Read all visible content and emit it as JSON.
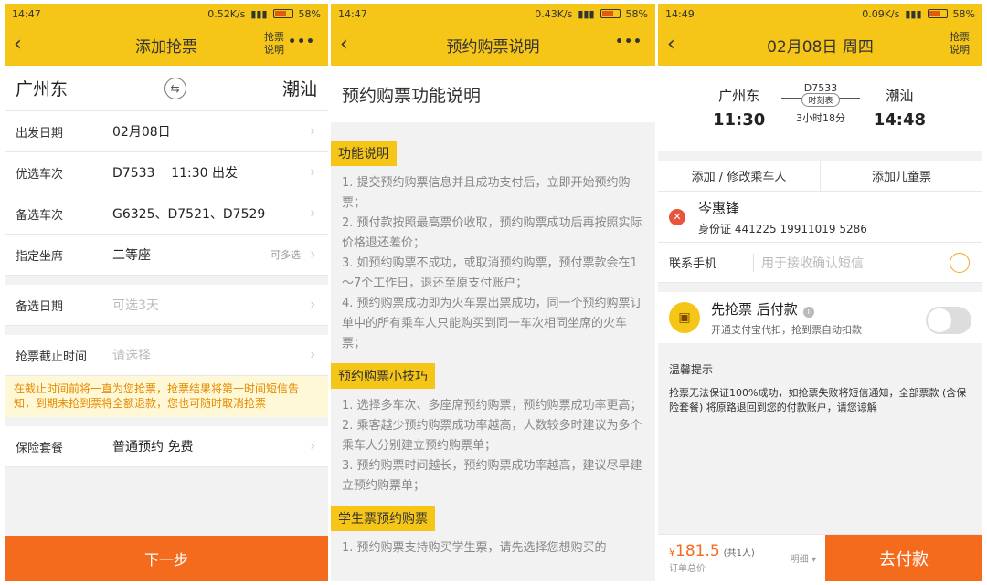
{
  "screen1": {
    "status": {
      "time": "14:47",
      "speed": "0.52K/s",
      "battery": "58%"
    },
    "nav": {
      "title": "添加抢票",
      "grab": "抢票\n说明",
      "more": "•••"
    },
    "from_city": "广州东",
    "to_city": "潮汕",
    "rows": [
      {
        "label": "出发日期",
        "value": "02月08日"
      },
      {
        "label": "优选车次",
        "value": "D7533    11:30 出发"
      },
      {
        "label": "备选车次",
        "value": "G6325、D7521、D7529"
      },
      {
        "label": "指定坐席",
        "value": "二等座",
        "side": "可多选"
      }
    ],
    "alt_date": {
      "label": "备选日期",
      "placeholder": "可选3天"
    },
    "deadline": {
      "label": "抢票截止时间",
      "placeholder": "请选择"
    },
    "notice": "在截止时间前将一直为您抢票，抢票结果将第一时间短信告知，到期未抢到票将全额退款，您也可随时取消抢票",
    "insurance": {
      "label": "保险套餐",
      "value": "普通预约 免费"
    },
    "next_button": "下一步"
  },
  "screen2": {
    "status": {
      "time": "14:47",
      "speed": "0.43K/s",
      "battery": "58%"
    },
    "nav": {
      "title": "预约购票说明",
      "more": "•••"
    },
    "heading": "预约购票功能说明",
    "sections": [
      {
        "title": "功能说明",
        "paras": [
          "1. 提交预约购票信息并且成功支付后，立即开始预约购票；",
          "2. 预付款按照最高票价收取，预约购票成功后再按照实际价格退还差价；",
          "3. 如预约购票不成功，或取消预约购票，预付票款会在1～7个工作日，退还至原支付账户；",
          "4. 预约购票成功即为火车票出票成功，同一个预约购票订单中的所有乘车人只能购买到同一车次相同坐席的火车票；"
        ]
      },
      {
        "title": "预约购票小技巧",
        "paras": [
          "1. 选择多车次、多座席预约购票，预约购票成功率更高；",
          "2. 乘客越少预约购票成功率越高，人数较多时建议为多个乘车人分别建立预约购票单；",
          "3. 预约购票时间越长，预约购票成功率越高，建议尽早建立预约购票单；"
        ]
      },
      {
        "title": "学生票预约购票",
        "paras": [
          "1. 预约购票支持购买学生票，请先选择您想购买的"
        ]
      }
    ]
  },
  "screen3": {
    "status": {
      "time": "14:49",
      "speed": "0.09K/s",
      "battery": "58%"
    },
    "nav": {
      "title": "02月08日 周四",
      "grab": "抢票\n说明"
    },
    "trip": {
      "from": "广州东",
      "from_time": "11:30",
      "train": "D7533",
      "timetable": "时刻表",
      "duration": "3小时18分",
      "to": "潮汕",
      "to_time": "14:48"
    },
    "add_passenger": "添加 / 修改乘车人",
    "add_child": "添加儿童票",
    "passenger": {
      "name": "岑惠锋",
      "id": "身份证 441225 19911019 5286"
    },
    "phone": {
      "label": "联系手机",
      "placeholder": "用于接收确认短信"
    },
    "pay_later": {
      "title": "先抢票 后付款",
      "desc": "开通支付宝代扣，抢到票自动扣款"
    },
    "tips": {
      "title": "温馨提示",
      "body": "抢票无法保证100%成功，如抢票失败将短信通知，全部票款 (含保险套餐) 将原路退回到您的付款账户，请您谅解"
    },
    "footer": {
      "price": "181.5",
      "currency": "¥",
      "count": "(共1人)",
      "total": "订单总价",
      "detail": "明细 ▾",
      "pay": "去付款"
    }
  }
}
